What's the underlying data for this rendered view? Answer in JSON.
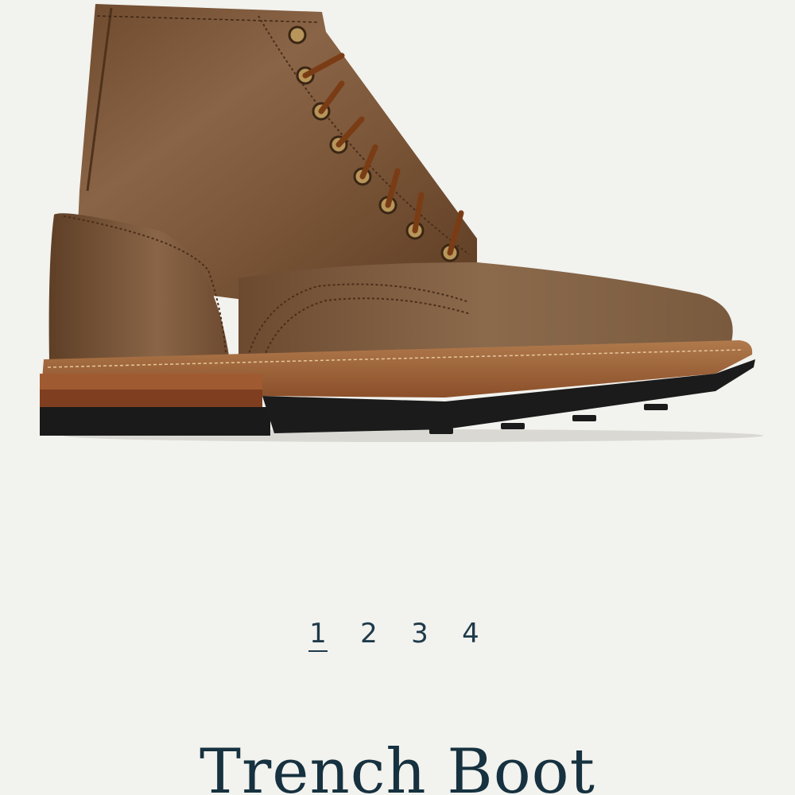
{
  "product": {
    "title": "Trench Boot",
    "image_alt": "boot-photo"
  },
  "gallery": {
    "pages": [
      "1",
      "2",
      "3",
      "4"
    ],
    "active_index": 0
  },
  "colors": {
    "background": "#f2f2ee",
    "text": "#16313f",
    "leather": "#8a5f3c",
    "sole": "#1b1b1b"
  }
}
